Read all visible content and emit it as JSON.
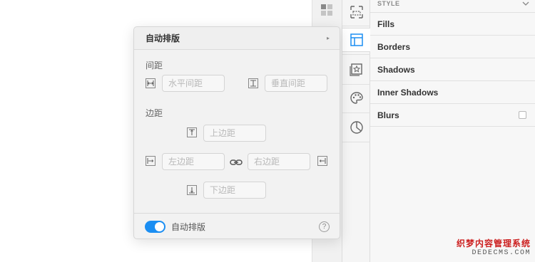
{
  "inspector": {
    "style_header": "STYLE",
    "rows": [
      {
        "label": "Fills"
      },
      {
        "label": "Borders"
      },
      {
        "label": "Shadows"
      },
      {
        "label": "Inner Shadows"
      },
      {
        "label": "Blurs"
      }
    ]
  },
  "iconbar": {
    "icons": [
      "selection-icon",
      "layout-icon",
      "symbol-icon",
      "palette-icon",
      "pie-chart-icon"
    ],
    "active_index": 1
  },
  "popover": {
    "title": "自动排版",
    "spacing_label": "间距",
    "horizontal_spacing_placeholder": "水平间距",
    "vertical_spacing_placeholder": "垂直间距",
    "padding_label": "边距",
    "top_padding_placeholder": "上边距",
    "left_padding_placeholder": "左边距",
    "right_padding_placeholder": "右边距",
    "bottom_padding_placeholder": "下边距",
    "toggle_label": "自动排版",
    "toggle_on": true,
    "help_glyph": "?"
  },
  "watermark": {
    "line1": "织梦内容管理系统",
    "line2": "DEDECMS.COM"
  },
  "colors": {
    "accent": "#1b8ef2",
    "active_icon": "#1b8ef2"
  }
}
